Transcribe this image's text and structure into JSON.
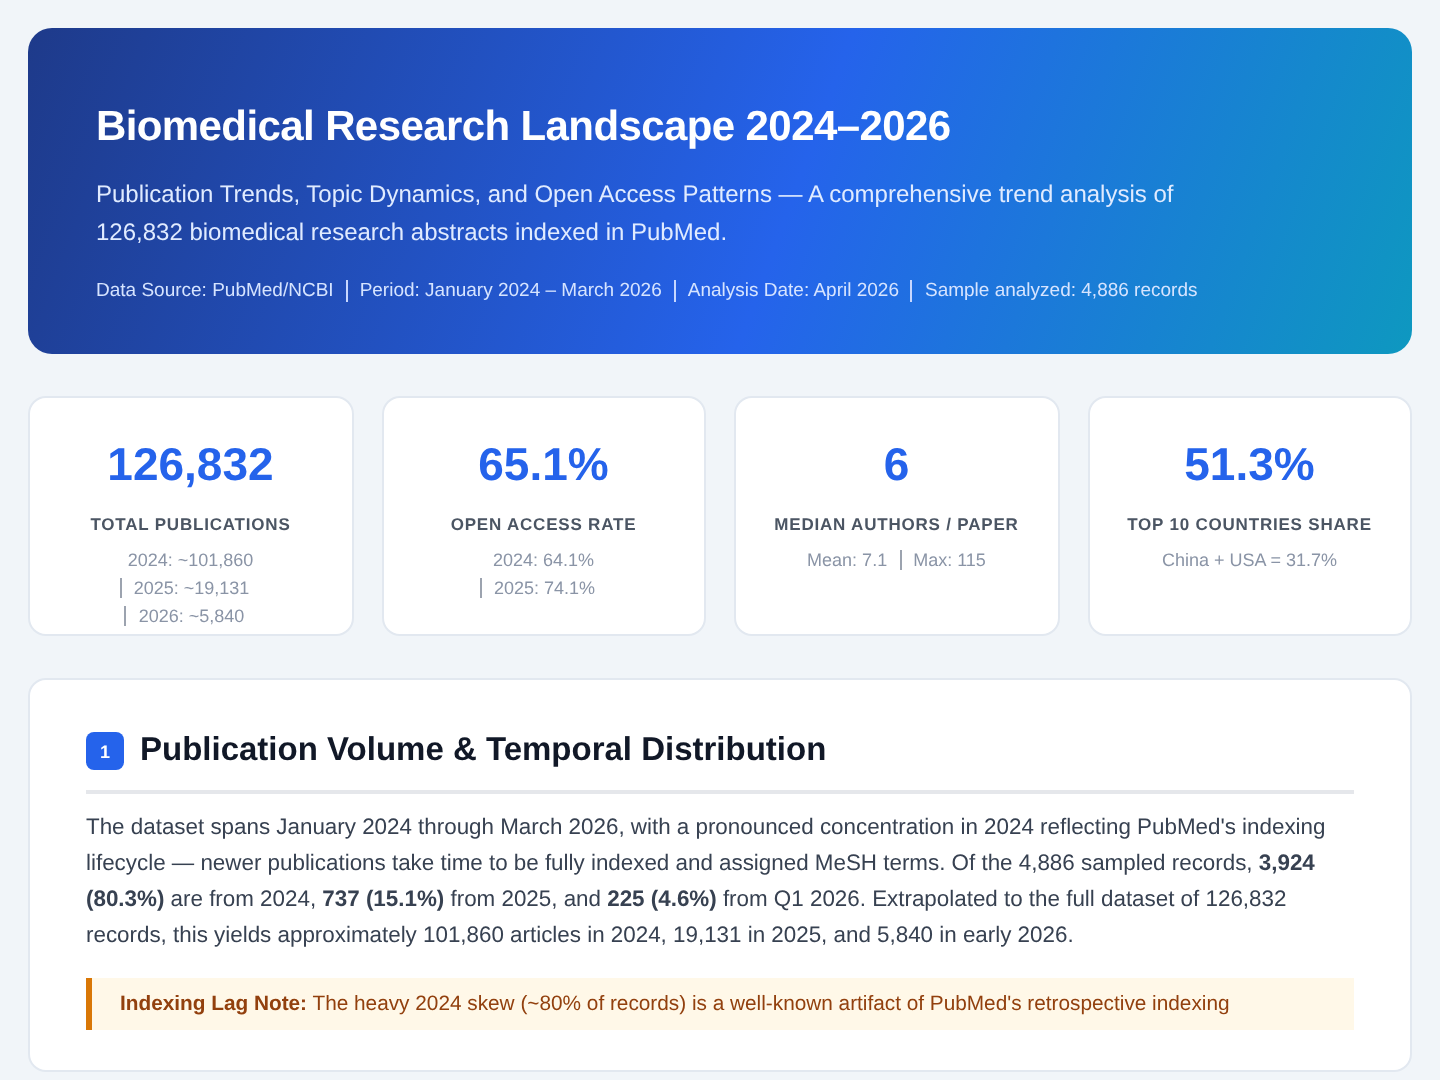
{
  "header": {
    "title": "Biomedical Research Landscape 2024–2026",
    "subtitle": "Publication Trends, Topic Dynamics, and Open Access Patterns — A comprehensive trend analysis of 126,832 biomedical research abstracts indexed in PubMed.",
    "meta": [
      "Data Source: PubMed/NCBI",
      "Period: January 2024 – March 2026",
      "Analysis Date: April 2026",
      "Sample analyzed: 4,886 records"
    ]
  },
  "stats": [
    {
      "value": "126,832",
      "label": "TOTAL PUBLICATIONS",
      "details": [
        "2024: ~101,860",
        "2025: ~19,131",
        "2026: ~5,840"
      ]
    },
    {
      "value": "65.1%",
      "label": "OPEN ACCESS RATE",
      "details": [
        "2024: 64.1%",
        "2025: 74.1%"
      ]
    },
    {
      "value": "6",
      "label": "MEDIAN AUTHORS / PAPER",
      "details": [
        "Mean: 7.1",
        "Max: 115"
      ]
    },
    {
      "value": "51.3%",
      "label": "TOP 10 COUNTRIES SHARE",
      "details": [
        "China + USA = 31.7%"
      ]
    }
  ],
  "section": {
    "number": "1",
    "title": "Publication Volume & Temporal Distribution",
    "paragraph": "The dataset spans January 2024 through March 2026, with a pronounced concentration in 2024 reflecting PubMed's indexing lifecycle — newer publications take time to be fully indexed and assigned MeSH terms. Of the 4,886 sampled records, **3,924 (80.3%)** are from 2024, **737 (15.1%)** from 2025, and **225 (4.6%)** from Q1 2026. Extrapolated to the full dataset of 126,832 records, this yields approximately 101,860 articles in 2024, 19,131 in 2025, and 5,840 in early 2026.",
    "note": "**Indexing Lag Note:** The heavy 2024 skew (~80% of records) is a well-known artifact of PubMed's retrospective indexing"
  }
}
